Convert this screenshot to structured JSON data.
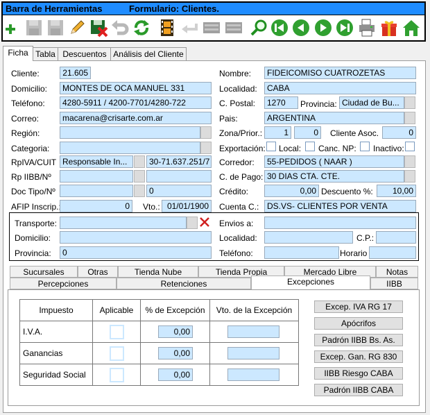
{
  "window": {
    "title_left": "Barra de Herramientas",
    "title_right": "Formulario: Clientes."
  },
  "toolbar": {
    "icons": [
      "add-icon",
      "save-disabled-icon",
      "save-disabled-icon",
      "edit-icon",
      "delete-save-icon",
      "undo-icon",
      "refresh-icon",
      "film-icon",
      "back-arrow-icon",
      "blank-icon",
      "blank-icon",
      "search-icon",
      "first-icon",
      "previous-icon",
      "next-icon",
      "last-icon",
      "printer-icon",
      "gift-icon",
      "home-icon"
    ]
  },
  "tabs_top": [
    "Ficha",
    "Tabla",
    "Descuentos",
    "Análisis del Cliente"
  ],
  "form": {
    "cliente_label": "Cliente:",
    "cliente": "21.605",
    "nombre_label": "Nombre:",
    "nombre": "FIDEICOMISO CUATROZETAS",
    "domicilio_label": "Domicilio:",
    "domicilio": "MONTES DE OCA MANUEL 331",
    "localidad_label": "Localidad:",
    "localidad": "CABA",
    "telefono_label": "Teléfono:",
    "telefono": "4280-5911 / 4200-7701/4280-722",
    "cpostal_label": "C. Postal:",
    "cpostal": "1270",
    "provincia_label": "Provincia:",
    "provincia": "Ciudad de Bu...",
    "correo_label": "Correo:",
    "correo": "macarena@crisarte.com.ar",
    "pais_label": "Pais:",
    "pais": "ARGENTINA",
    "region_label": "Región:",
    "zona_label": "Zona/Prior.:",
    "zona": "1",
    "prior": "0",
    "cliente_asoc_label": "Cliente Asoc.",
    "cliente_asoc": "0",
    "categoria_label": "Categoria:",
    "exportacion_label": "Exportación:",
    "local_label": "Local:",
    "canc_np_label": "Canc. NP:",
    "inactivo_label": "Inactivo:",
    "rpiva_label": "RpIVA/CUIT",
    "rpiva": "Responsable In...",
    "cuit": "30-71.637.251/7",
    "corredor_label": "Corredor:",
    "corredor": "55-PEDIDOS  ( NAAR )",
    "rp_iibb_label": "Rp IIBB/Nº",
    "cpago_label": "C. de Pago:",
    "cpago": "30 DIAS CTA. CTE.",
    "doc_tipo_label": "Doc Tipo/Nº",
    "doc_num": "0",
    "credito_label": "Crédito:",
    "credito": "0,00",
    "descuento_label": "Descuento %:",
    "descuento": "10,00",
    "afip_label": "AFIP Inscrip.:",
    "afip": "0",
    "vto_label": "Vto.:",
    "vto": "01/01/1900",
    "cuenta_label": "Cuenta C.:",
    "cuenta": "DS.VS- CLIENTES POR VENTA"
  },
  "transporte": {
    "transporte_label": "Transporte:",
    "envios_label": "Envios a:",
    "domicilio_label": "Domicilio:",
    "localidad_label": "Localidad:",
    "cp_label": "C.P.:",
    "provincia_label": "Provincia:",
    "provincia": "0",
    "telefono_label": "Teléfono:",
    "horario_label": "Horario"
  },
  "tabs_bottom_row1": [
    "Sucursales",
    "Otras",
    "Tienda Nube",
    "Tienda Propia",
    "Mercado Libre",
    "Notas"
  ],
  "tabs_bottom_row2": [
    "Percepciones",
    "Retenciones",
    "Excepciones",
    "IIBB"
  ],
  "excepciones": {
    "headers": [
      "Impuesto",
      "Aplicable",
      "% de Excepción",
      "Vto. de la Excepción"
    ],
    "rows": [
      {
        "impuesto": "I.V.A.",
        "pct": "0,00"
      },
      {
        "impuesto": "Ganancias",
        "pct": "0,00"
      },
      {
        "impuesto": "Seguridad Social",
        "pct": "0,00"
      }
    ],
    "buttons": [
      "Excep. IVA RG 17",
      "Apócrifos",
      "Padrón IIBB Bs. As.",
      "Excep. Gan. RG 830",
      "IIBB Riesgo CABA",
      "Padrón IIBB CABA"
    ]
  }
}
